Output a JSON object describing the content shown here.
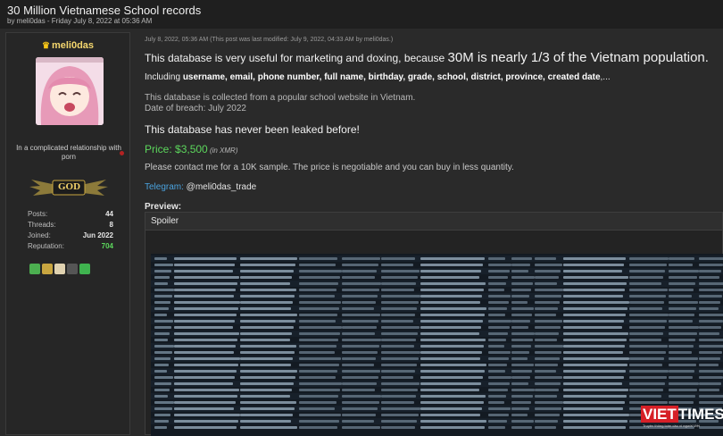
{
  "thread": {
    "title": "30 Million Vietnamese School records",
    "meta_prefix": "by ",
    "author": "meli0das",
    "meta_date": " - Friday July 8, 2022 at 05:36 AM"
  },
  "sidebar": {
    "username": "meli0das",
    "status": "In a complicated relationship with porn",
    "rank": "GOD",
    "stats": [
      {
        "label": "Posts:",
        "value": "44"
      },
      {
        "label": "Threads:",
        "value": "8"
      },
      {
        "label": "Joined:",
        "value": "Jun 2022"
      },
      {
        "label": "Reputation:",
        "value": "704"
      }
    ]
  },
  "post": {
    "date": "July 8, 2022, 05:36 AM  (This post was last modified: July 9, 2022, 04:33 AM by meli0das.)",
    "l1a": "This database is very useful for marketing and doxing, because ",
    "l1b": "30M is nearly 1/3 of the Vietnam population.",
    "including": "Including ",
    "fields": "username, email, phone number, full name, birthday, grade, school, district, province, created date",
    "fields_tail": ",...",
    "collected": "This database is collected from a popular school website in Vietnam.",
    "breach": "Date of breach: July 2022",
    "never": "This database has never been leaked before!",
    "price_label": "Price: ",
    "price_value": "$3,500",
    "price_unit": " (in XMR)",
    "contact": "Please contact me for a 10K sample. The price is negotiable and you can buy in less quantity.",
    "telegram_label": "Telegram:",
    "telegram_handle": " @meli0das_trade",
    "preview_label": "Preview:",
    "spoiler_label": "Spoiler"
  },
  "watermark": {
    "brand": "VIETTIMES",
    "tagline": "Truyền thông toàn cầu vì người Việt"
  },
  "colors": {
    "accent_green": "#5cd65c",
    "link_blue": "#4aa3df",
    "username_gold": "#f5d76e",
    "brand_red": "#d62027"
  }
}
